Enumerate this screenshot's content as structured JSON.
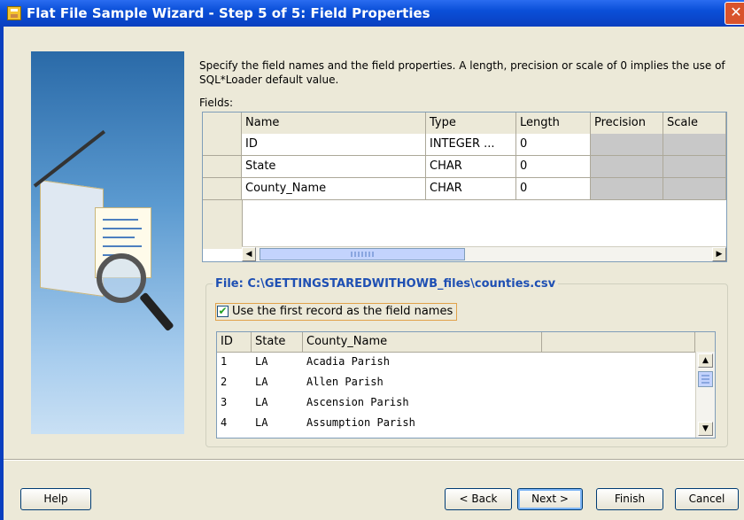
{
  "window": {
    "title": "Flat File Sample Wizard - Step 5 of 5: Field Properties",
    "close_glyph": "✕"
  },
  "description": "Specify the field names and the field properties.  A length, precision or scale of 0 implies the use of SQL*Loader default value.",
  "fields_label": "Fields:",
  "fields_grid": {
    "columns": [
      "Name",
      "Type",
      "Length",
      "Precision",
      "Scale"
    ],
    "rows": [
      {
        "name": "ID",
        "type": "INTEGER ...",
        "length": "0",
        "precision": "",
        "scale": ""
      },
      {
        "name": "State",
        "type": "CHAR",
        "length": "0",
        "precision": "",
        "scale": ""
      },
      {
        "name": "County_Name",
        "type": "CHAR",
        "length": "0",
        "precision": "",
        "scale": ""
      }
    ],
    "scroll_left": "◀",
    "scroll_right": "▶"
  },
  "file_group": {
    "legend": "File: C:\\GETTINGSTAREDWITHOWB_files\\counties.csv",
    "checkbox_label": "Use the first record as the field names",
    "checkbox_checked": true,
    "checkbox_glyph": "✔"
  },
  "preview_grid": {
    "columns": [
      "ID",
      "State",
      "County_Name",
      ""
    ],
    "rows": [
      {
        "id": "1",
        "state": "LA",
        "county": "Acadia Parish"
      },
      {
        "id": "2",
        "state": "LA",
        "county": "Allen Parish"
      },
      {
        "id": "3",
        "state": "LA",
        "county": "Ascension Parish"
      },
      {
        "id": "4",
        "state": "LA",
        "county": "Assumption Parish"
      }
    ],
    "scroll_up": "▲",
    "scroll_down": "▼"
  },
  "buttons": {
    "help": "Help",
    "back": "< Back",
    "next": "Next >",
    "finish": "Finish",
    "cancel": "Cancel"
  },
  "icons": {
    "app": "wizard-app-icon",
    "close": "close-icon"
  },
  "colors": {
    "title_bar": "#0a4fd8",
    "legend_text": "#1e4fb3",
    "disabled_cell": "#c8c8c8"
  }
}
